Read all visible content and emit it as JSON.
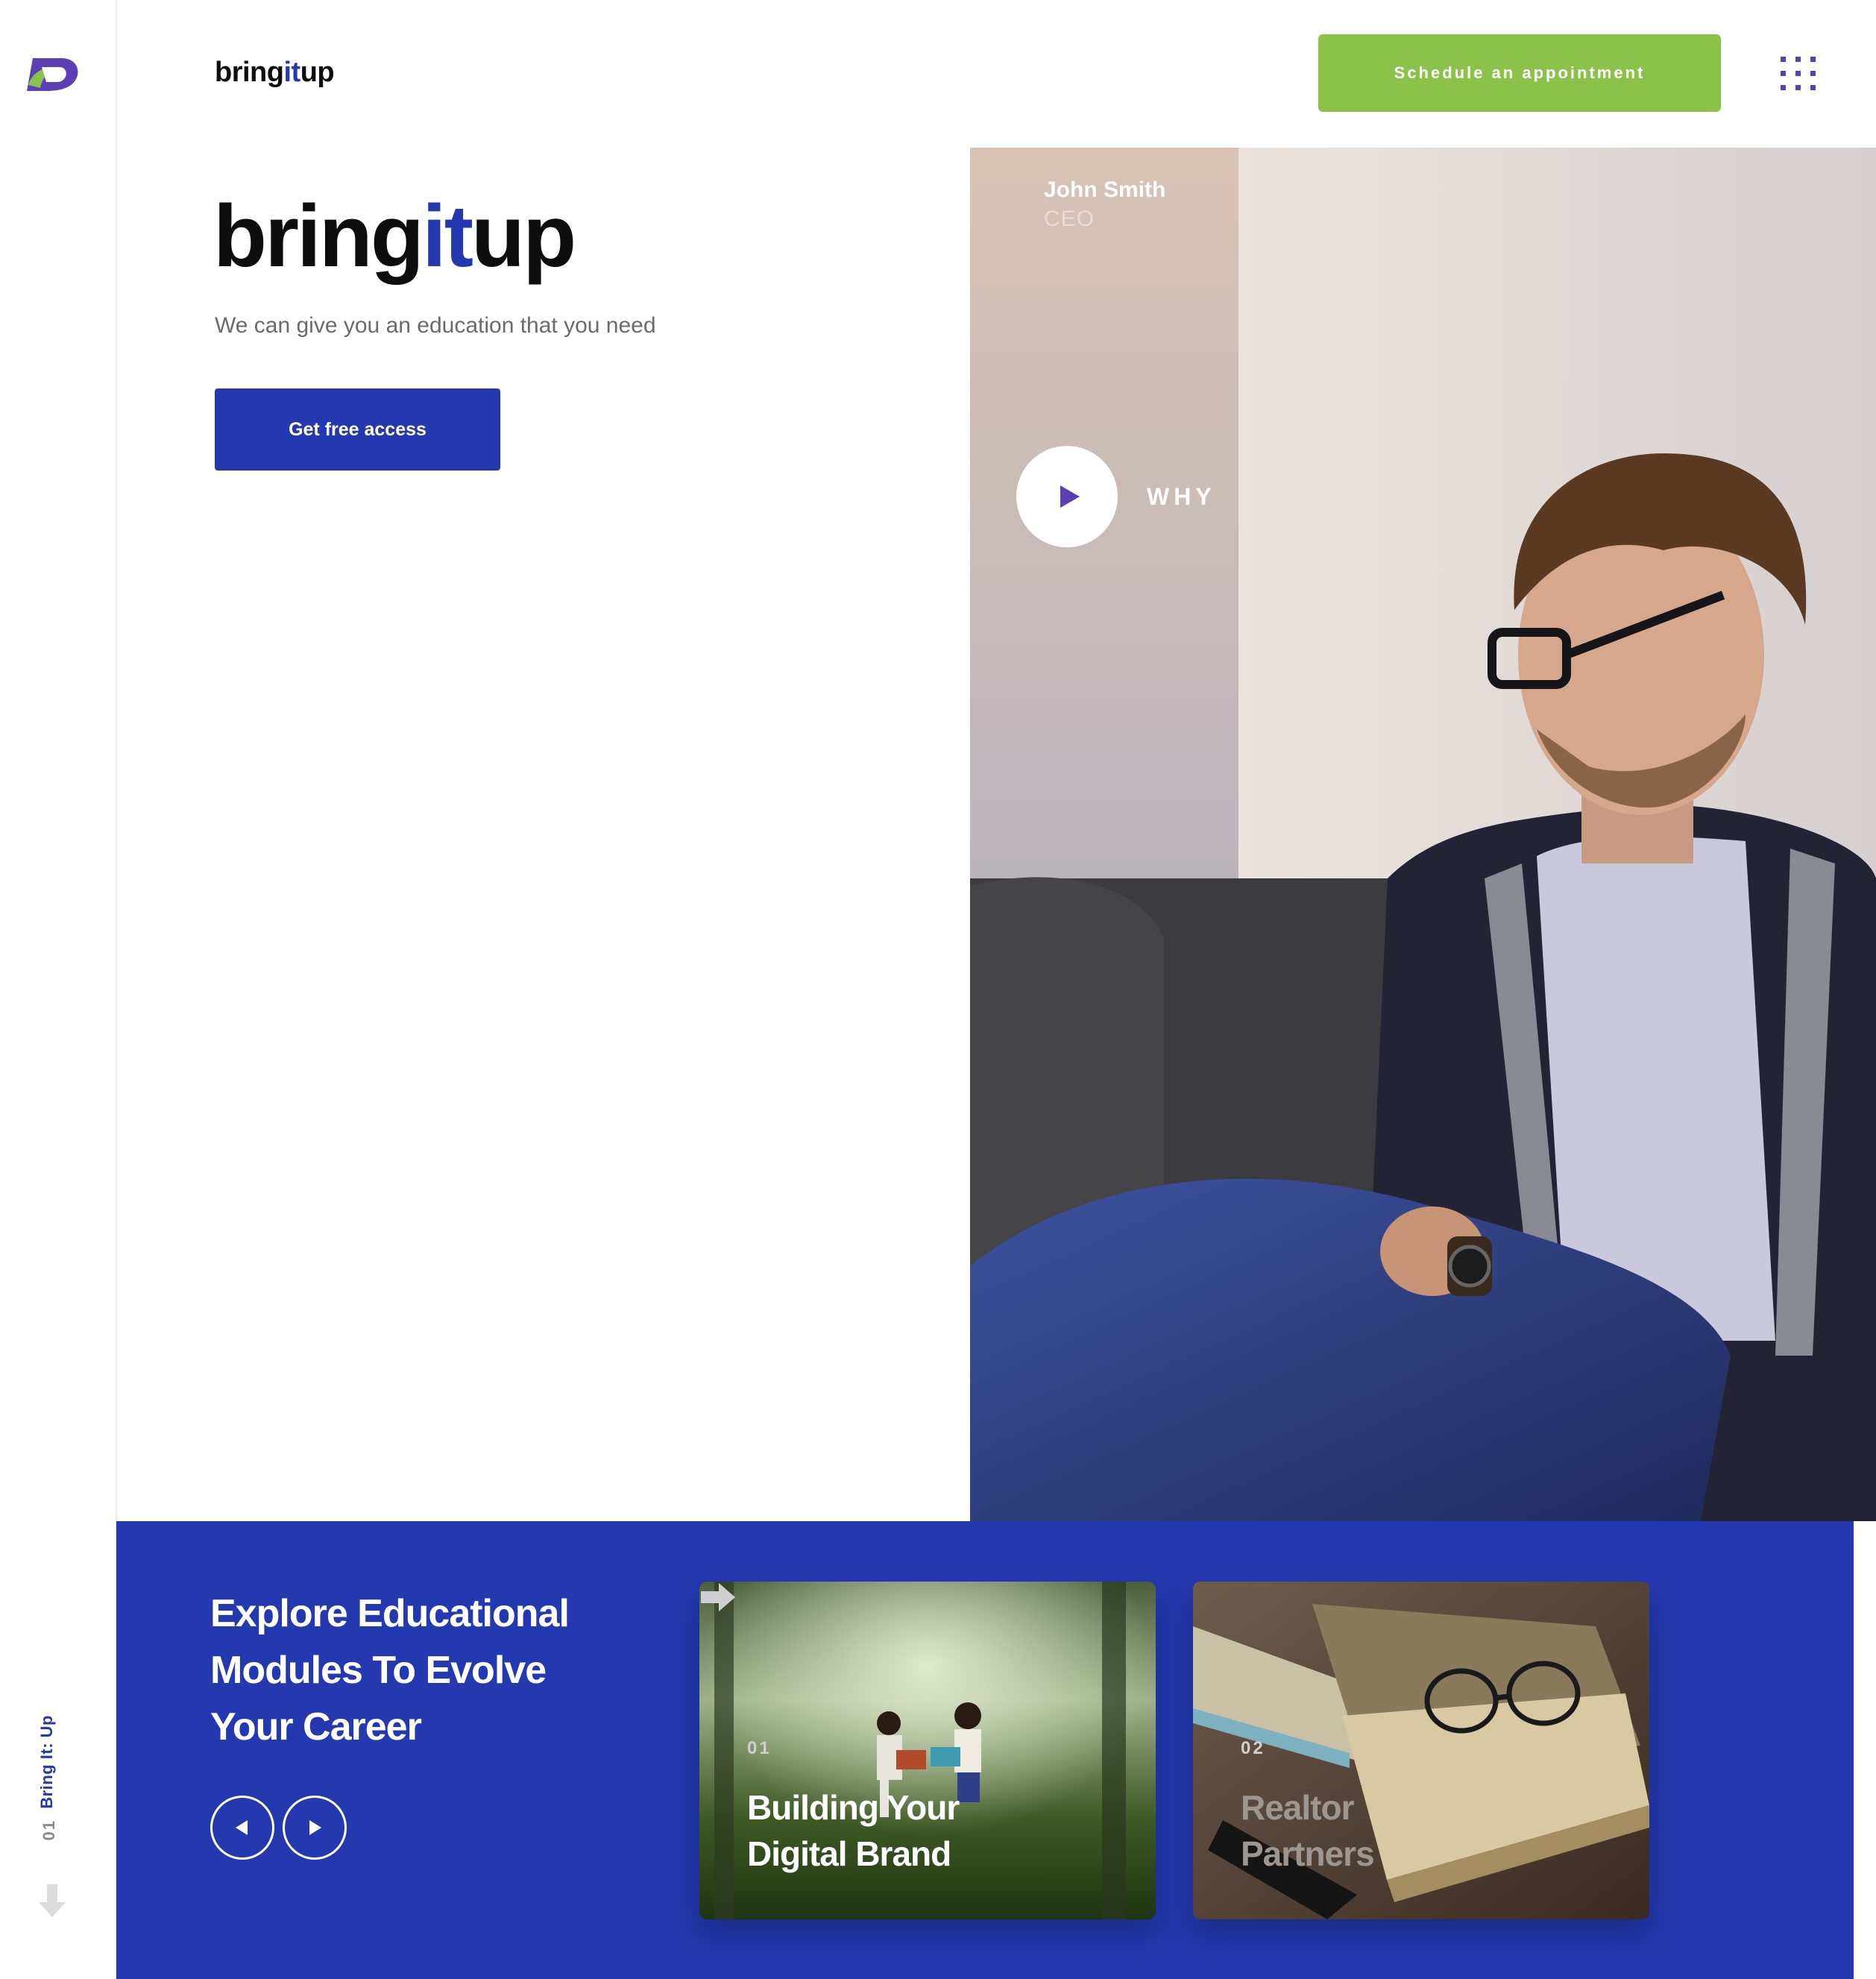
{
  "header": {
    "brand": {
      "pre": "bring",
      "mid": "it",
      "post": "up"
    },
    "cta_label": "Schedule an appointment",
    "menu_icon": "grid-menu-icon"
  },
  "hero": {
    "brand": {
      "pre": "bring",
      "mid": "it",
      "post": "up"
    },
    "tagline": "We can give you an education that you need",
    "cta_label": "Get free access"
  },
  "video": {
    "person_name": "John Smith",
    "person_role": "CEO",
    "why_label": "WHY",
    "play_icon": "play-icon"
  },
  "sidebar": {
    "title": "Bring It: Up",
    "slide_number": "01",
    "scroll_icon": "arrow-down-icon"
  },
  "explore": {
    "heading_lines": [
      "Explore Educational",
      "Modules To Evolve",
      "Your Career"
    ],
    "cards": [
      {
        "number": "01",
        "title_lines": [
          "Building Your",
          "Digital Brand"
        ]
      },
      {
        "number": "02",
        "title_lines": [
          "Realtor",
          "Partners"
        ]
      }
    ]
  },
  "colors": {
    "primary_blue": "#2438b0",
    "accent_green": "#8dc24a",
    "menu_purple": "#5b3fb3"
  }
}
